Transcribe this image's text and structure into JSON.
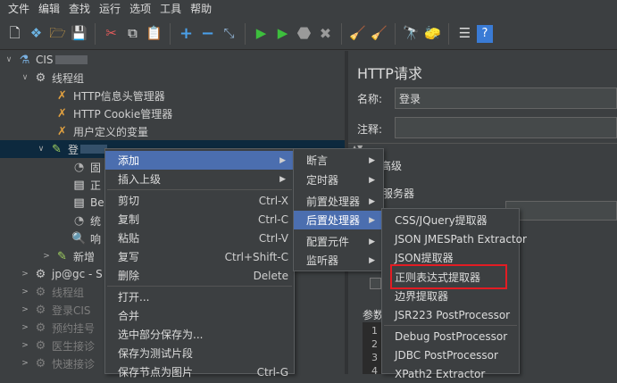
{
  "menubar": [
    "文件",
    "编辑",
    "查找",
    "运行",
    "选项",
    "工具",
    "帮助"
  ],
  "tree": {
    "root": "CIS",
    "thread_group": "线程组",
    "http_header": "HTTP信息头管理器",
    "http_cookie": "HTTP Cookie管理器",
    "user_vars": "用户定义的变量",
    "login": "登",
    "child1": "固",
    "child2": "正",
    "child3": "Be",
    "child4": "统",
    "child5": "响",
    "new_add": "新增",
    "jp": "jp@gc - S",
    "tg2": "线程组",
    "login_cis": "登录CIS",
    "reserve": "预约挂号",
    "doctor": "医生接诊",
    "fast": "快速接诊"
  },
  "right": {
    "title": "HTTP请求",
    "name_label": "名称:",
    "name_value": "登录",
    "comment_label": "注释:",
    "advanced": "高级",
    "server": "服务器",
    "params": "参数",
    "rows": [
      "1",
      "2",
      "3",
      "4"
    ]
  },
  "ctx_main": {
    "items": [
      {
        "label": "添加",
        "shortcut": "",
        "arrow": true
      },
      {
        "label": "插入上级",
        "shortcut": "",
        "arrow": true
      },
      {
        "label": "剪切",
        "shortcut": "Ctrl-X",
        "arrow": false
      },
      {
        "label": "复制",
        "shortcut": "Ctrl-C",
        "arrow": false
      },
      {
        "label": "粘贴",
        "shortcut": "Ctrl-V",
        "arrow": false
      },
      {
        "label": "复写",
        "shortcut": "Ctrl+Shift-C",
        "arrow": false
      },
      {
        "label": "删除",
        "shortcut": "Delete",
        "arrow": false
      },
      {
        "label": "打开...",
        "shortcut": "",
        "arrow": false
      },
      {
        "label": "合并",
        "shortcut": "",
        "arrow": false
      },
      {
        "label": "选中部分保存为...",
        "shortcut": "",
        "arrow": false
      },
      {
        "label": "保存为测试片段",
        "shortcut": "",
        "arrow": false
      },
      {
        "label": "保存节点为图片",
        "shortcut": "Ctrl-G",
        "arrow": false
      }
    ]
  },
  "ctx_add": {
    "items": [
      {
        "label": "断言",
        "arrow": true
      },
      {
        "label": "定时器",
        "arrow": true
      },
      {
        "label": "前置处理器",
        "arrow": true
      },
      {
        "label": "后置处理器",
        "arrow": true
      },
      {
        "label": "配置元件",
        "arrow": true
      },
      {
        "label": "监听器",
        "arrow": true
      }
    ]
  },
  "ctx_post": {
    "items": [
      "CSS/JQuery提取器",
      "JSON JMESPath Extractor",
      "JSON提取器",
      "正则表达式提取器",
      "边界提取器",
      "JSR223 PostProcessor",
      "Debug PostProcessor",
      "JDBC PostProcessor",
      "XPath2 Extractor"
    ]
  },
  "highlight_color": "#4b6eaf",
  "annotation_color": "#e31c23"
}
